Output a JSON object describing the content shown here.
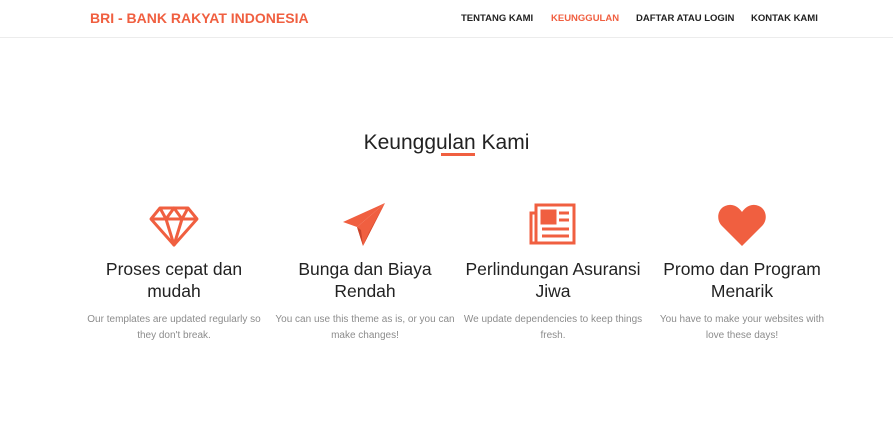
{
  "brand": "BRI - BANK RAKYAT INDONESIA",
  "nav": [
    {
      "label": "TENTANG KAMI",
      "active": false
    },
    {
      "label": "KEUNGGULAN",
      "active": true
    },
    {
      "label": "DAFTAR ATAU LOGIN",
      "active": false
    },
    {
      "label": "KONTAK KAMI",
      "active": false
    }
  ],
  "section": {
    "title": "Keunggulan Kami"
  },
  "features": [
    {
      "icon": "diamond-icon",
      "title": "Proses cepat dan mudah",
      "text": "Our templates are updated regularly so they don't break."
    },
    {
      "icon": "paper-plane-icon",
      "title": "Bunga dan Biaya Rendah",
      "text": "You can use this theme as is, or you can make changes!"
    },
    {
      "icon": "newspaper-icon",
      "title": "Perlindungan Asuransi Jiwa",
      "text": "We update dependencies to keep things fresh."
    },
    {
      "icon": "heart-icon",
      "title": "Promo dan Program Menarik",
      "text": "You have to make your websites with love these days!"
    }
  ],
  "colors": {
    "accent": "#f05f40",
    "text": "#222222",
    "muted": "#8c8c8c"
  }
}
